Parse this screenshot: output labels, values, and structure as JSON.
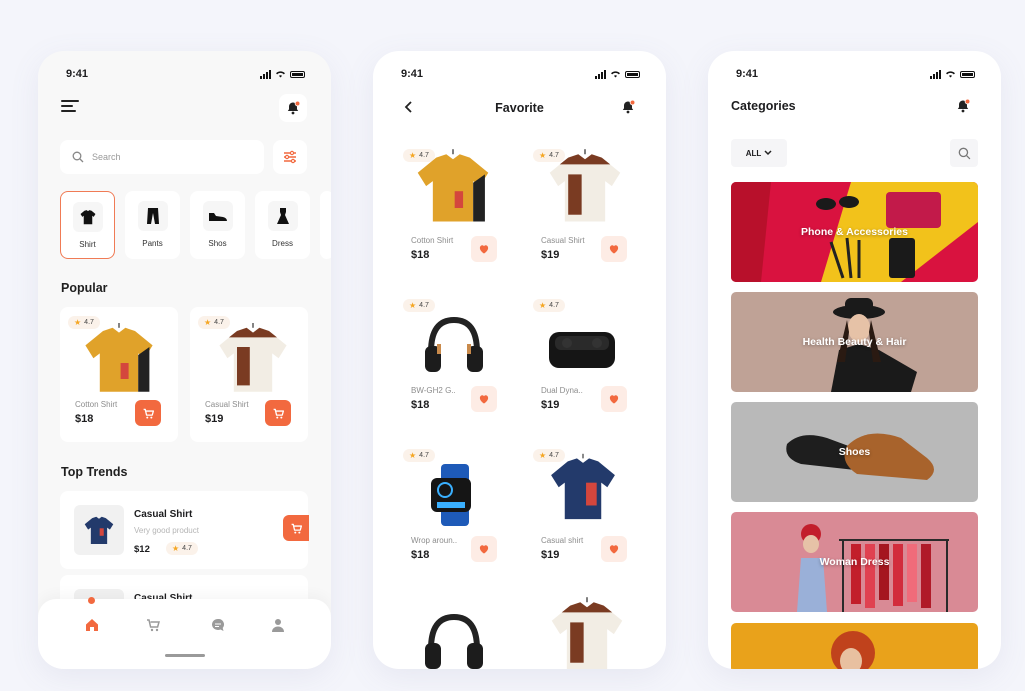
{
  "status_time": "9:41",
  "colors": {
    "accent": "#f2693f",
    "accent_light": "#fdece5",
    "star": "#f5a623"
  },
  "home": {
    "search_placeholder": "Search",
    "categories": [
      {
        "label": "Shirt",
        "icon": "shirt-icon",
        "active": true
      },
      {
        "label": "Pants",
        "icon": "pants-icon"
      },
      {
        "label": "Shos",
        "icon": "shoe-icon"
      },
      {
        "label": "Dress",
        "icon": "dress-icon"
      }
    ],
    "popular_title": "Popular",
    "popular": [
      {
        "rating": "4.7",
        "name": "Cotton Shirt",
        "price": "$18"
      },
      {
        "rating": "4.7",
        "name": "Casual Shirt",
        "price": "$19"
      }
    ],
    "top_trends_title": "Top Trends",
    "trends": [
      {
        "name": "Casual Shirt",
        "subtitle": "Very good product",
        "price": "$12",
        "rating": "4.7"
      },
      {
        "name": "Casual Shirt"
      }
    ],
    "nav": [
      "home-icon",
      "cart-icon",
      "chat-icon",
      "profile-icon"
    ]
  },
  "favorite": {
    "title": "Favorite",
    "items": [
      {
        "rating": "4.7",
        "name": "Cotton Shirt",
        "price": "$18",
        "image": "yellow-shirt"
      },
      {
        "rating": "4.7",
        "name": "Casual Shirt",
        "price": "$19",
        "image": "brown-shirt"
      },
      {
        "rating": "4.7",
        "name": "BW-GH2 G..",
        "price": "$18",
        "image": "headphones"
      },
      {
        "rating": "4.7",
        "name": "Dual Dyna..",
        "price": "$19",
        "image": "earbuds-case"
      },
      {
        "rating": "4.7",
        "name": "Wrop aroun..",
        "price": "$18",
        "image": "smartwatch"
      },
      {
        "rating": "4.7",
        "name": "Casual shirt",
        "price": "$19",
        "image": "navy-shirt"
      }
    ]
  },
  "categories_screen": {
    "title": "Categories",
    "filter_label": "ALL",
    "banners": [
      {
        "label": "Phone & Accessories",
        "bg": "#d9123f"
      },
      {
        "label": "Health Beauty & Hair",
        "bg": "#bfa296"
      },
      {
        "label": "Shoes",
        "bg": "#b9b9b9"
      },
      {
        "label": "Woman Dress",
        "bg": "#d98a95"
      },
      {
        "label": "",
        "bg": "#e9a21b"
      }
    ]
  }
}
